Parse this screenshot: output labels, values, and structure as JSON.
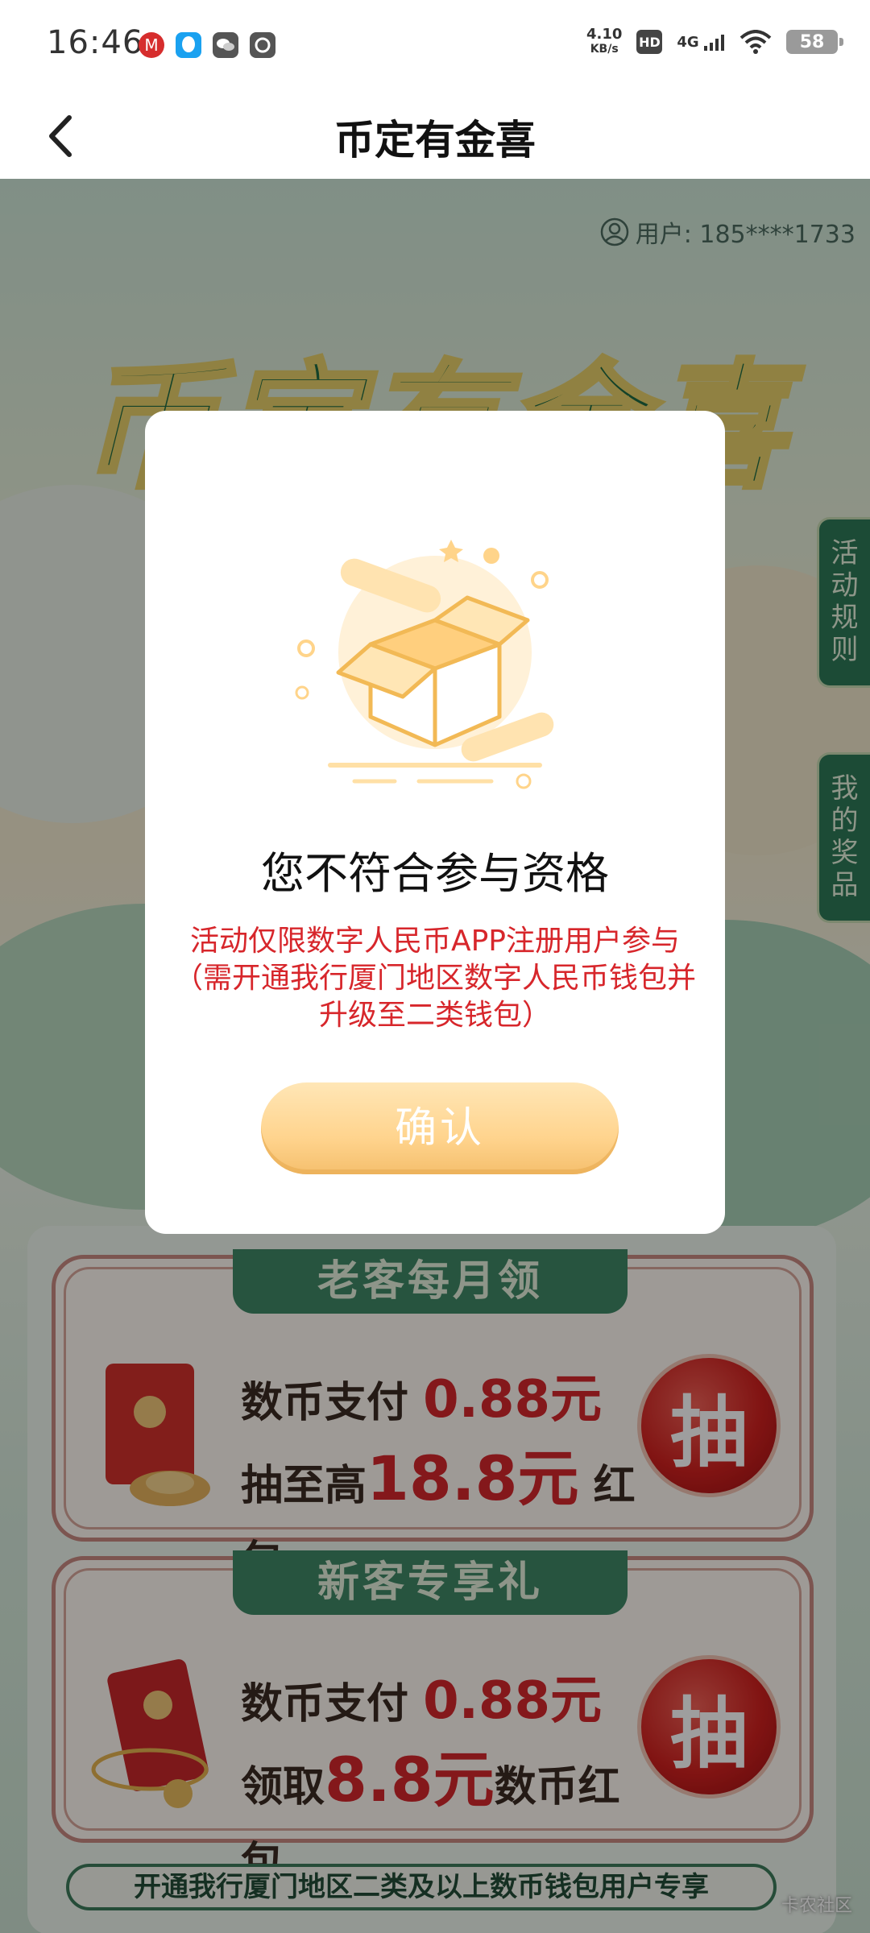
{
  "status_bar": {
    "time": "16:46",
    "net_speed_value": "4.10",
    "net_speed_unit": "KB/s",
    "hd": "HD",
    "network": "4G",
    "battery": "58",
    "apps": [
      "china-merchants-icon",
      "qq-icon",
      "wechat-icon",
      "camera-icon"
    ]
  },
  "nav": {
    "title": "币定有金喜"
  },
  "page": {
    "user_label": "用户: 185****1733",
    "hero_title": "币定有金喜",
    "side_tabs": {
      "rules": "活动规则",
      "prizes": "我的奖品"
    },
    "cards": [
      {
        "ribbon": "老客每月领",
        "line1_prefix": "数币支付",
        "line1_amount": "0.88元",
        "line2_prefix": "抽至高",
        "line2_amount": "18.8元",
        "line2_suffix": "红包",
        "button": "抽"
      },
      {
        "ribbon": "新客专享礼",
        "line1_prefix": "数币支付",
        "line1_amount": "0.88元",
        "line2_prefix": "领取",
        "line2_amount": "8.8元",
        "line2_suffix": "数币红包",
        "button": "抽"
      }
    ],
    "footer_note": "开通我行厦门地区二类及以上数币钱包用户专享",
    "watermark": "卡农社区"
  },
  "modal": {
    "title": "您不符合参与资格",
    "message": "活动仅限数字人民币APP注册用户参与（需开通我行厦门地区数字人民币钱包并升级至二类钱包）",
    "confirm_label": "确认"
  },
  "colors": {
    "brand_green": "#2e7a57",
    "alert_red": "#d7262b",
    "confirm_gold": "#ffd48e",
    "draw_red": "#d1211f"
  }
}
